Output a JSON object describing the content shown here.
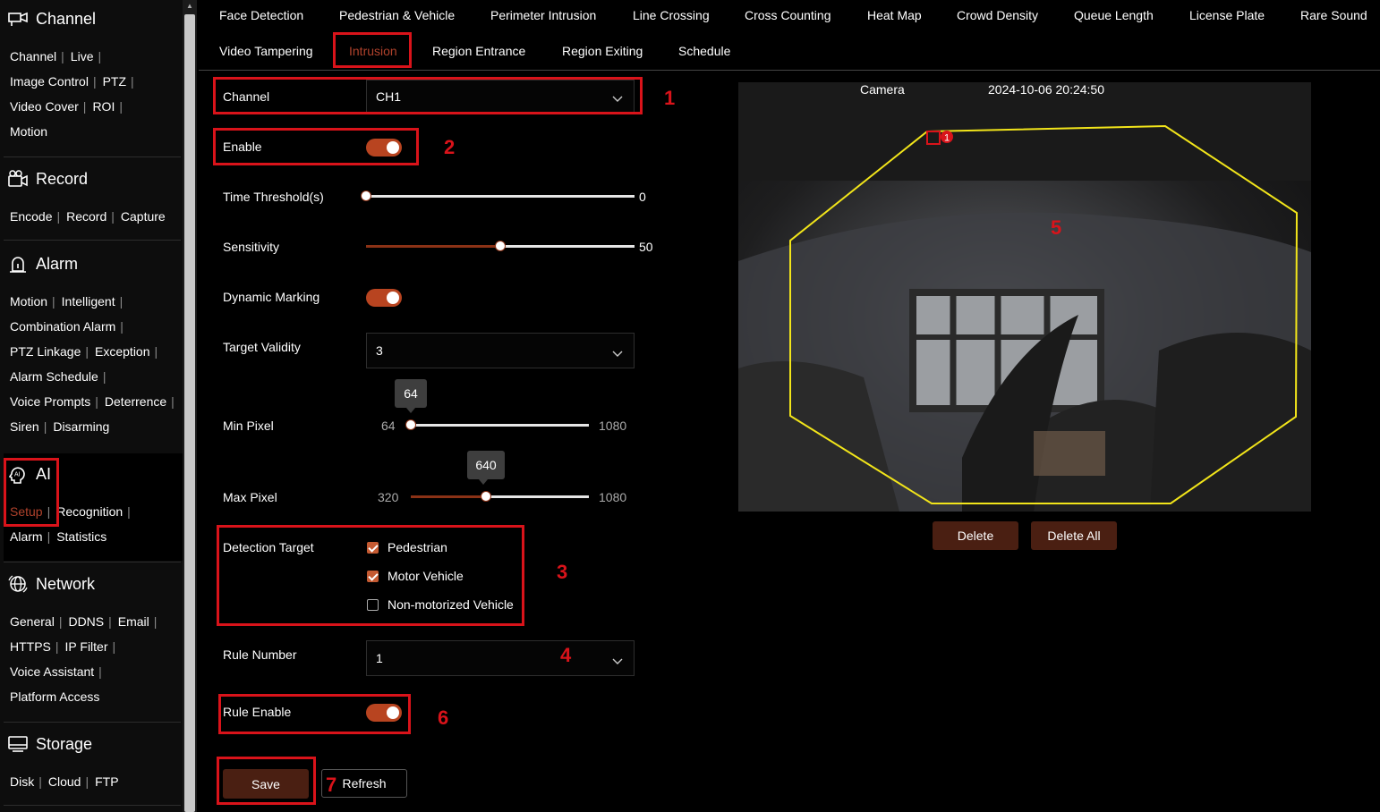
{
  "sidebar": {
    "channel": {
      "title": "Channel",
      "icon": "channel-icon",
      "rows": [
        [
          "Channel",
          "Live"
        ],
        [
          "Image Control",
          "PTZ"
        ],
        [
          "Video Cover",
          "ROI"
        ],
        [
          "Motion"
        ]
      ]
    },
    "record": {
      "title": "Record",
      "icon": "record-icon",
      "rows": [
        [
          "Encode",
          "Record",
          "Capture"
        ]
      ]
    },
    "alarm": {
      "title": "Alarm",
      "icon": "alarm-icon",
      "rows": [
        [
          "Motion",
          "Intelligent"
        ],
        [
          "Combination Alarm"
        ],
        [
          "PTZ Linkage",
          "Exception"
        ],
        [
          "Alarm Schedule"
        ],
        [
          "Voice Prompts",
          "Deterrence"
        ],
        [
          "Siren",
          "Disarming"
        ]
      ]
    },
    "ai": {
      "title": "AI",
      "icon": "ai-icon",
      "rows": [
        [
          "Setup",
          "Recognition"
        ],
        [
          "Alarm",
          "Statistics"
        ]
      ]
    },
    "network": {
      "title": "Network",
      "icon": "network-icon",
      "rows": [
        [
          "General",
          "DDNS",
          "Email"
        ],
        [
          "HTTPS",
          "IP Filter"
        ],
        [
          "Voice Assistant"
        ],
        [
          "Platform Access"
        ]
      ]
    },
    "storage": {
      "title": "Storage",
      "icon": "storage-icon",
      "rows": [
        [
          "Disk",
          "Cloud",
          "FTP"
        ]
      ]
    }
  },
  "tabs": {
    "row1": [
      "Face Detection",
      "Pedestrian & Vehicle",
      "Perimeter Intrusion",
      "Line Crossing",
      "Cross Counting",
      "Heat Map",
      "Crowd Density",
      "Queue Length",
      "License Plate",
      "Rare Sound"
    ],
    "row2": [
      "Video Tampering",
      "Intrusion",
      "Region Entrance",
      "Region Exiting",
      "Schedule"
    ],
    "active": "Intrusion"
  },
  "form": {
    "channel_label": "Channel",
    "channel_value": "CH1",
    "enable_label": "Enable",
    "time_threshold_label": "Time Threshold(s)",
    "time_threshold_value": "0",
    "sensitivity_label": "Sensitivity",
    "sensitivity_value": "50",
    "dynamic_marking_label": "Dynamic Marking",
    "target_validity_label": "Target Validity",
    "target_validity_value": "3",
    "min_pixel_label": "Min Pixel",
    "min_pixel_min": "64",
    "min_pixel_max": "1080",
    "min_pixel_value": "64",
    "max_pixel_label": "Max Pixel",
    "max_pixel_min": "320",
    "max_pixel_max": "1080",
    "max_pixel_value": "640",
    "detection_target_label": "Detection Target",
    "targets": [
      {
        "label": "Pedestrian",
        "checked": true
      },
      {
        "label": "Motor Vehicle",
        "checked": true
      },
      {
        "label": "Non-motorized Vehicle",
        "checked": false
      }
    ],
    "rule_number_label": "Rule Number",
    "rule_number_value": "1",
    "rule_enable_label": "Rule Enable",
    "save_label": "Save",
    "refresh_label": "Refresh"
  },
  "levels": {
    "time_threshold": 0.0,
    "sensitivity": 0.5,
    "min_pixel": 0.0,
    "max_pixel": 0.42
  },
  "camera": {
    "osd_name": "Camera",
    "osd_time": "2024-10-06 20:24:50",
    "region_marker": "1",
    "delete_label": "Delete",
    "delete_all_label": "Delete All"
  },
  "annotations": {
    "n1": "1",
    "n2": "2",
    "n3": "3",
    "n4": "4",
    "n5": "5",
    "n6": "6",
    "n7": "7"
  },
  "colors": {
    "accent": "#b84420",
    "highlight": "#d9131a",
    "region": "#f2e51a",
    "button": "#4a1f12"
  }
}
